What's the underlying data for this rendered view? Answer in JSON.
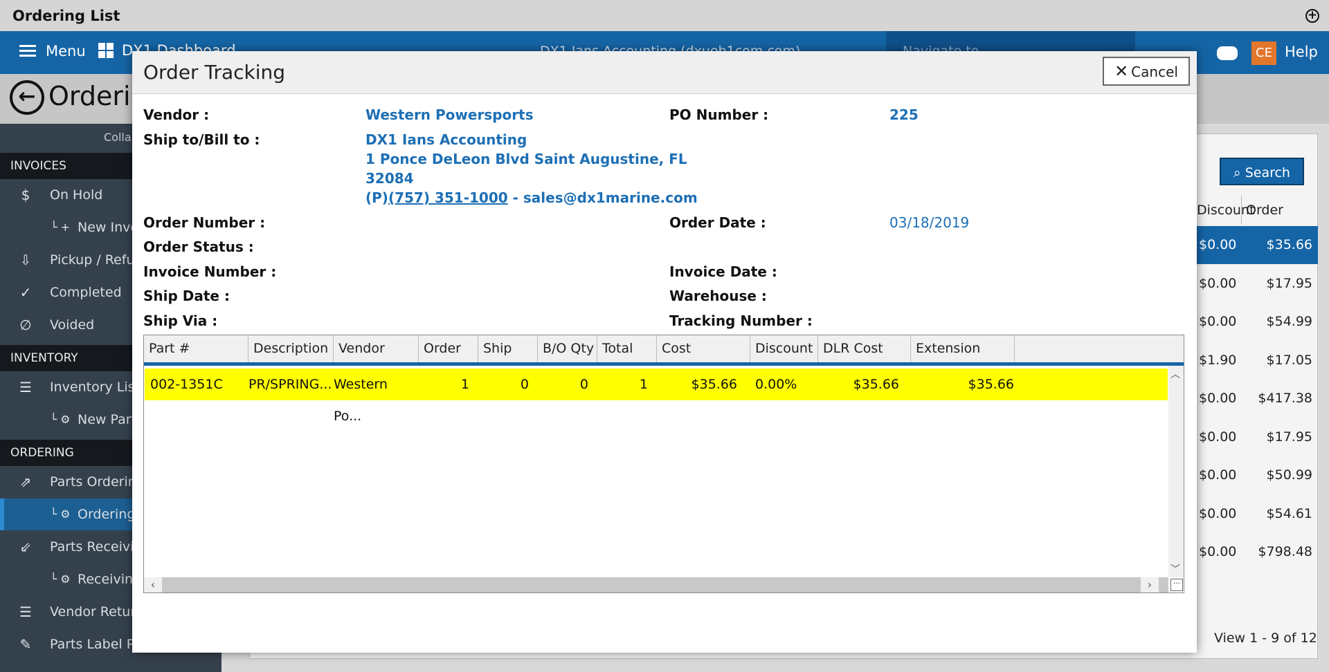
{
  "window": {
    "title": "Ordering List"
  },
  "topnav": {
    "menu_label": "Menu",
    "dashboard_label": "DX1 Dashboard",
    "account_label": "DX1 Ians Accounting (dxueb1com.com)",
    "navigate_placeholder": "Navigate to",
    "user_initials": "CE",
    "help_label": "Help"
  },
  "page": {
    "title": "Ordering List"
  },
  "sidebar": {
    "collapse_label": "Collapse",
    "sections": {
      "invoices": "INVOICES",
      "inventory": "INVENTORY",
      "ordering": "ORDERING"
    },
    "items": {
      "on_hold": "On Hold",
      "new_invoice": "New Invoice",
      "pickup_refund": "Pickup / Refund",
      "completed": "Completed",
      "voided": "Voided",
      "inventory_list": "Inventory List",
      "new_part": "New Part",
      "parts_ordering": "Parts Ordering",
      "ordering_list": "Ordering List",
      "parts_receiving": "Parts Receiving",
      "receiving_list": "Receiving List",
      "vendor_return": "Vendor Return",
      "parts_label_printing": "Parts Label Printing"
    }
  },
  "background_list": {
    "search_label": "Search",
    "col_discount": "Discount",
    "col_order_amount": "Order Am...",
    "rows": [
      {
        "discount": "$0.00",
        "amount": "$35.66"
      },
      {
        "discount": "$0.00",
        "amount": "$17.95"
      },
      {
        "discount": "$0.00",
        "amount": "$54.99"
      },
      {
        "discount": "$1.90",
        "amount": "$17.05"
      },
      {
        "discount": "$0.00",
        "amount": "$417.38"
      },
      {
        "discount": "$0.00",
        "amount": "$17.95"
      },
      {
        "discount": "$0.00",
        "amount": "$50.99"
      },
      {
        "discount": "$0.00",
        "amount": "$54.61"
      },
      {
        "discount": "$0.00",
        "amount": "$798.48"
      }
    ],
    "view_text": "View 1 - 9 of 12"
  },
  "modal": {
    "title": "Order Tracking",
    "cancel_label": "Cancel",
    "labels": {
      "vendor": "Vendor :",
      "ship_bill": "Ship to/Bill to :",
      "po_number": "PO Number :",
      "order_number": "Order Number :",
      "order_date": "Order Date :",
      "order_status": "Order Status :",
      "invoice_number": "Invoice Number :",
      "invoice_date": "Invoice Date :",
      "ship_date": "Ship Date :",
      "warehouse": "Warehouse :",
      "ship_via": "Ship Via :",
      "tracking_number": "Tracking Number :"
    },
    "values": {
      "vendor": "Western Powersports",
      "po_number": "225",
      "ship_name": "DX1 Ians Accounting",
      "ship_address": "1 Ponce DeLeon Blvd Saint Augustine, FL",
      "ship_zip": "32084",
      "phone_prefix": "(P)",
      "phone": "(757) 351-1000",
      "email_sep": " - ",
      "email": "sales@dx1marine.com",
      "order_date": "03/18/2019"
    },
    "grid": {
      "columns": [
        "Part #",
        "Description",
        "Vendor",
        "Order Qty",
        "Ship Qty",
        "B/O Qty",
        "Total",
        "Cost",
        "Discount",
        "DLR Cost",
        "Extension"
      ],
      "rows": [
        {
          "part": "002-1351C",
          "description": "PR/SPRING...",
          "vendor": "Western Po...",
          "order_qty": "1",
          "ship_qty": "0",
          "bo_qty": "0",
          "total": "1",
          "cost": "$35.66",
          "discount": "0.00%",
          "dlr_cost": "$35.66",
          "extension": "$35.66"
        }
      ]
    }
  }
}
